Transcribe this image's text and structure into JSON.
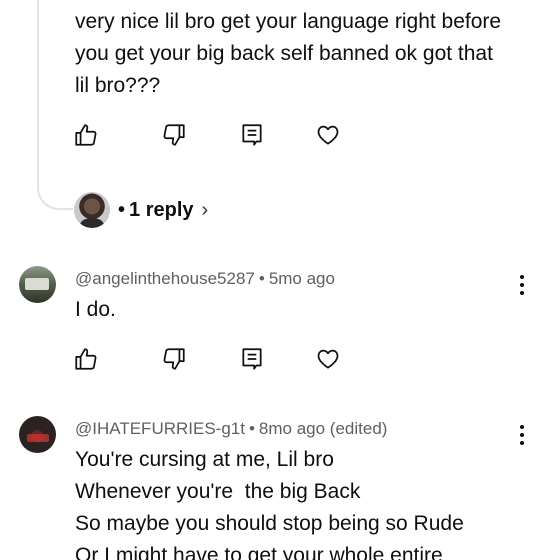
{
  "parent_comment": {
    "text_lines": [
      "very nice lil bro get your language right before",
      "you get your big back self banned ok got that",
      "lil bro???"
    ],
    "replies_label": "1 reply",
    "replies_dot": "•",
    "replies_chevron": "›"
  },
  "comments": [
    {
      "handle": "@angelinthehouse5287",
      "separator": "•",
      "time": "5mo ago",
      "text_lines": [
        "I do."
      ]
    },
    {
      "handle": "@IHATEFURRIES-g1t",
      "separator": "•",
      "time": "8mo ago (edited)",
      "text_lines": [
        "You're cursing at me, Lil bro",
        "Whenever you're  the big Back",
        "So maybe you should stop being so Rude",
        "Or I might have to get your whole entire"
      ]
    }
  ],
  "icons": {
    "like": "thumbs-up-icon",
    "dislike": "thumbs-down-icon",
    "reply": "reply-comment-icon",
    "heart": "heart-icon",
    "more": "more-vertical-icon"
  },
  "colors": {
    "text": "#0f0f0f",
    "meta": "#606060",
    "thread_line": "#e3e3e3"
  }
}
